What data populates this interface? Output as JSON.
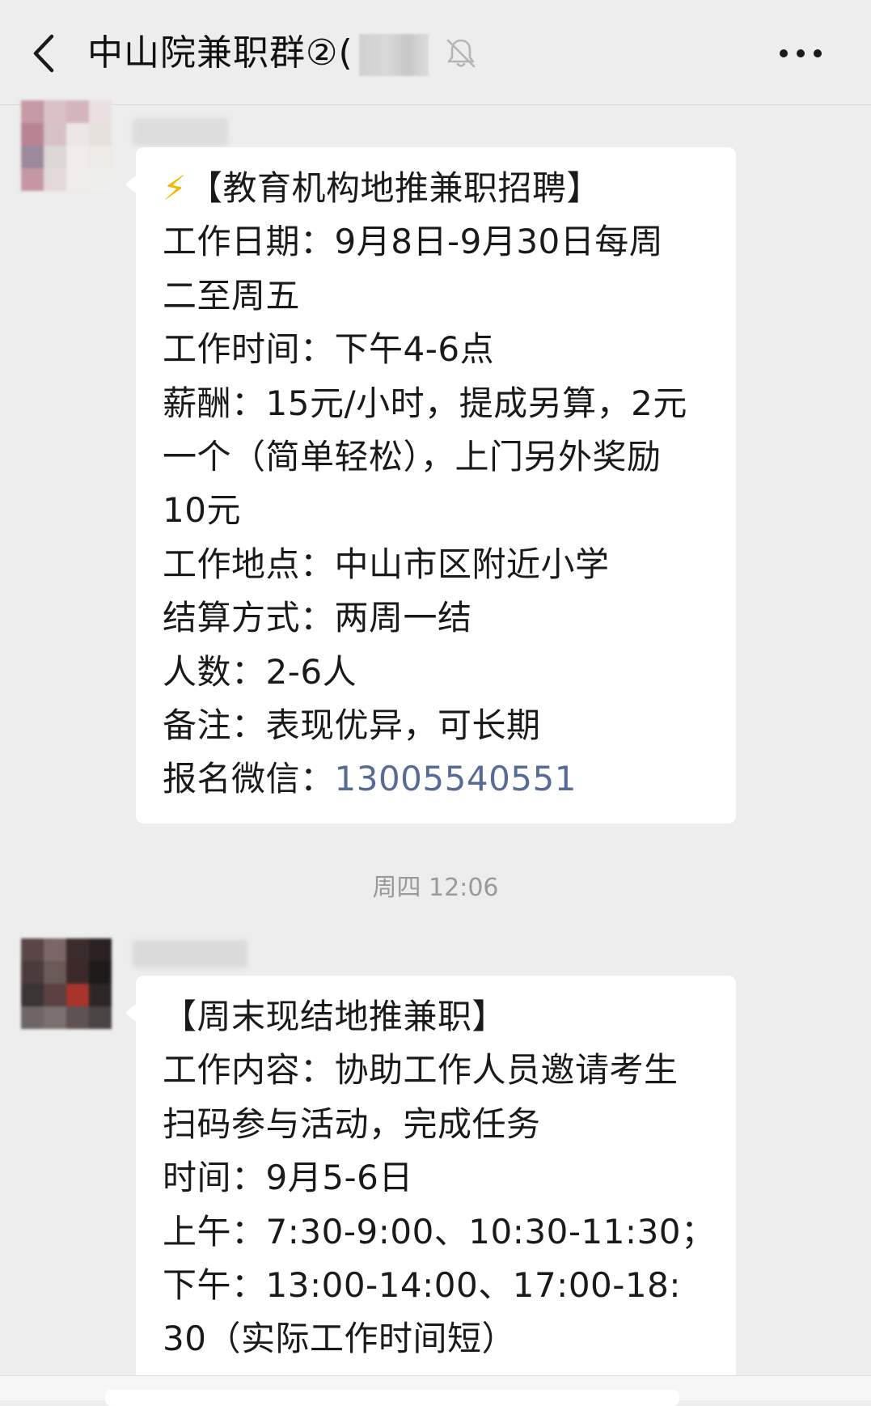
{
  "header": {
    "title": "中山院兼职群②(",
    "icons": {
      "back": "chevron-left-icon",
      "mute": "bell-muted-icon",
      "more": "more-horizontal-icon"
    }
  },
  "messages": [
    {
      "lines": [
        "【教育机构地推兼职招聘】",
        "工作日期：9月8日-9月30日每周",
        "二至周五",
        "工作时间：下午4-6点",
        "薪酬：15元/小时，提成另算，2元",
        "一个（简单轻松），上门另外奖励",
        "10元",
        "工作地点：中山市区附近小学",
        "结算方式：两周一结",
        "人数：2-6人",
        "备注：表现优异，可长期"
      ],
      "lead_emoji": "⚡",
      "contact_label": "报名微信：",
      "contact_value": "13005540551"
    },
    {
      "lines": [
        "【周末现结地推兼职】",
        "工作内容：协助工作人员邀请考生",
        "扫码参与活动，完成任务",
        "时间：9月5-6日",
        "上午：7:30-9:00、10:30-11:30；",
        "下午：13:00-14:00、17:00-18:",
        "30（实际工作时间短）"
      ]
    }
  ],
  "timestamp": "周四 12:06",
  "colors": {
    "background": "#ededed",
    "bubble": "#ffffff",
    "link": "#576b95",
    "text": "#1a1a1a",
    "timestamp": "#9a9a9a"
  }
}
